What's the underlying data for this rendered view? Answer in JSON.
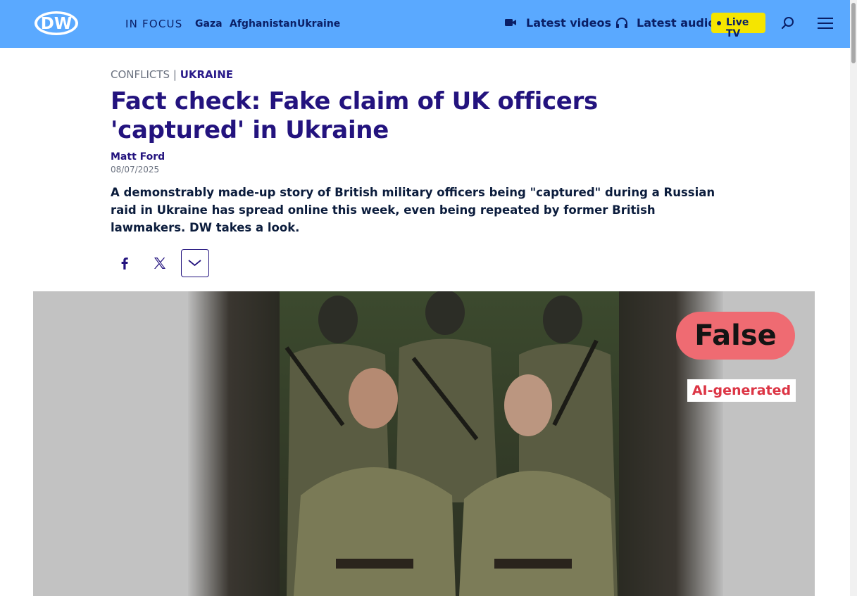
{
  "header": {
    "logo_text": "DW",
    "in_focus_label": "IN FOCUS",
    "focus_links": [
      "Gaza",
      "Afghanistan",
      "Ukraine"
    ],
    "latest_videos_label": "Latest videos",
    "latest_audio_label": "Latest audio",
    "live_tv_label": "Live TV",
    "colors": {
      "bar": "#5aa9ff",
      "live": "#f5e500",
      "text": "#0a1f66"
    },
    "icons": [
      "video-camera-icon",
      "headphones-icon",
      "search-icon",
      "menu-icon"
    ]
  },
  "article": {
    "category": "CONFLICTS",
    "separator": "|",
    "subcategory": "UKRAINE",
    "title": "Fact check: Fake claim of UK officers 'captured' in Ukraine",
    "author": "Matt Ford",
    "date": "08/07/2025",
    "lede": "A demonstrably made-up story of British military officers being \"captured\" during a Russian raid in Ukraine has spread online this week, even being repeated by former British lawmakers. DW takes a look.",
    "share_icons": [
      "facebook-icon",
      "x-icon",
      "chevron-down-icon"
    ]
  },
  "hero": {
    "verdict_label": "False",
    "tag_label": "AI-generated",
    "colors": {
      "verdict_bg": "#ef6b72",
      "tag_text": "#dc3545"
    }
  }
}
